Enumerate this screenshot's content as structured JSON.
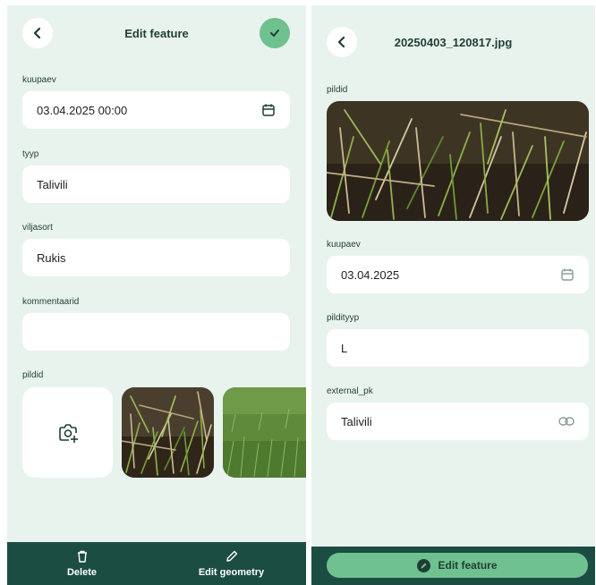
{
  "left": {
    "header": {
      "title": "Edit feature"
    },
    "fields": [
      {
        "label": "kuupaev",
        "value": "03.04.2025 00:00",
        "icon": "calendar-icon"
      },
      {
        "label": "tyyp",
        "value": "Talivili"
      },
      {
        "label": "viljasort",
        "value": "Rukis"
      },
      {
        "label": "kommentaarid",
        "value": ""
      }
    ],
    "photos_label": "pildid",
    "bottom_bar": {
      "delete_label": "Delete",
      "edit_geometry_label": "Edit geometry"
    }
  },
  "right": {
    "header": {
      "title": "20250403_120817.jpg"
    },
    "image_label": "pildid",
    "fields": [
      {
        "label": "kuupaev",
        "value": "03.04.2025",
        "icon": "calendar-icon"
      },
      {
        "label": "pildityyp",
        "value": "L"
      },
      {
        "label": "external_pk",
        "value": "Talivili",
        "icon": "link-icon"
      }
    ],
    "footer": {
      "edit_feature_label": "Edit feature"
    }
  },
  "colors": {
    "background": "#e9f3ee",
    "accent": "#6fc18f",
    "bar": "#1b4d43",
    "text": "#1f3e35"
  }
}
